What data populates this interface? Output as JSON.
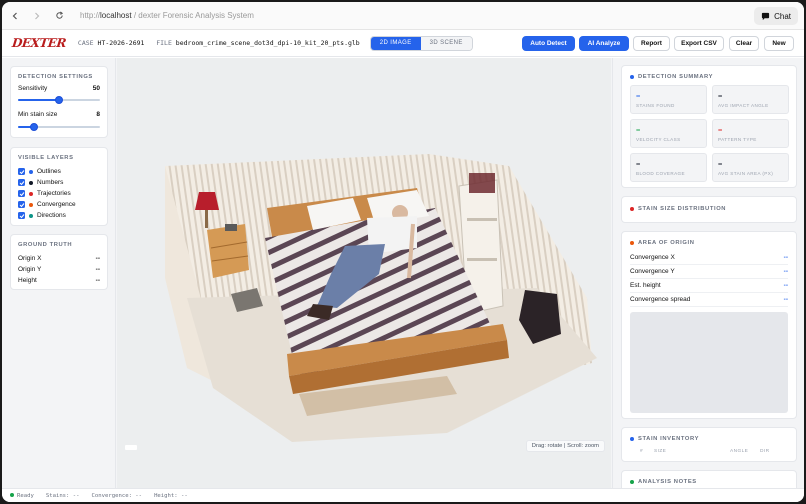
{
  "browser": {
    "url_scheme": "http://",
    "url_host": "localhost",
    "url_sep": " / ",
    "url_title": "dexter Forensic Analysis System",
    "chat_label": "Chat"
  },
  "app": {
    "logo": "DEXTER",
    "case_label": "CASE",
    "case_id": "HT-2026-2691",
    "file_label": "FILE",
    "file_name": "bedroom_crime_scene_dot3d_dpi-10_kit_20_pts.glb",
    "view_tabs": [
      {
        "label": "2D IMAGE",
        "active": true
      },
      {
        "label": "3D SCENE",
        "active": false
      }
    ],
    "buttons": {
      "auto_detect": "Auto Detect",
      "ai_analyze": "AI Analyze",
      "report": "Report",
      "export_csv": "Export CSV",
      "clear": "Clear",
      "new": "New"
    }
  },
  "detection_settings": {
    "title": "Detection Settings",
    "sensitivity_label": "Sensitivity",
    "sensitivity_value": "50",
    "sensitivity_fraction": 0.5,
    "min_stain_label": "Min stain size",
    "min_stain_value": "8",
    "min_stain_fraction": 0.2
  },
  "visible_layers": {
    "title": "Visible Layers",
    "items": [
      {
        "label": "Outlines",
        "checked": true,
        "color": "#2563eb"
      },
      {
        "label": "Numbers",
        "checked": true,
        "color": "#111827"
      },
      {
        "label": "Trajectories",
        "checked": true,
        "color": "#dc2626"
      },
      {
        "label": "Convergence",
        "checked": true,
        "color": "#ea580c"
      },
      {
        "label": "Directions",
        "checked": true,
        "color": "#0d9488"
      }
    ]
  },
  "ground_truth": {
    "title": "Ground Truth",
    "rows": [
      {
        "label": "Origin X",
        "value": "--"
      },
      {
        "label": "Origin Y",
        "value": "--"
      },
      {
        "label": "Height",
        "value": "--"
      }
    ]
  },
  "viewport": {
    "hint": "Drag: rotate | Scroll: zoom"
  },
  "detection_summary": {
    "title": "Detection Summary",
    "accent": "#2563eb",
    "stats": [
      {
        "value": "--",
        "label": "Stains found",
        "color": "#2563eb"
      },
      {
        "value": "--",
        "label": "Avg impact angle",
        "color": "#111827"
      },
      {
        "value": "--",
        "label": "Velocity class",
        "color": "#16a34a"
      },
      {
        "value": "--",
        "label": "Pattern type",
        "color": "#dc2626"
      },
      {
        "value": "--",
        "label": "Blood coverage",
        "color": "#111827"
      },
      {
        "value": "--",
        "label": "Avg stain area (px)",
        "color": "#111827"
      }
    ]
  },
  "stain_size_distribution": {
    "title": "Stain Size Distribution",
    "accent": "#dc2626"
  },
  "area_of_origin": {
    "title": "Area of Origin",
    "accent": "#ea580c",
    "rows": [
      {
        "label": "Convergence X",
        "value": "--"
      },
      {
        "label": "Convergence Y",
        "value": "--"
      },
      {
        "label": "Est. height",
        "value": "--"
      },
      {
        "label": "Convergence spread",
        "value": "--"
      }
    ]
  },
  "stain_inventory": {
    "title": "Stain Inventory",
    "accent": "#2563eb",
    "columns": [
      "#",
      "Size",
      "Angle",
      "Dir"
    ]
  },
  "analysis_notes": {
    "title": "Analysis Notes",
    "accent": "#16a34a"
  },
  "status": {
    "ready": "Ready",
    "stains": "Stains: --",
    "convergence": "Convergence: --",
    "height": "Height: --"
  }
}
